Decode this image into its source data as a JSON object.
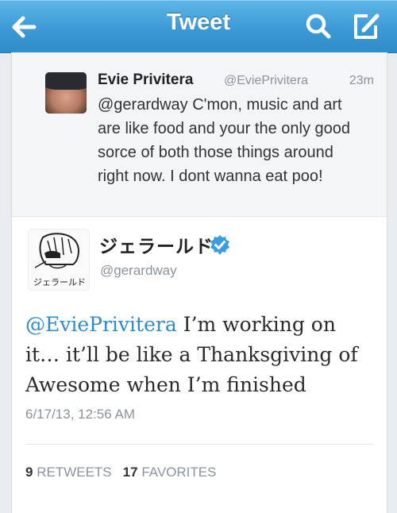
{
  "nav": {
    "title": "Tweet",
    "back_icon": "back-arrow-icon",
    "search_icon": "search-icon",
    "compose_icon": "compose-icon"
  },
  "reply_tweet": {
    "name": "Evie Privitera",
    "handle": "@EviePrivitera",
    "time": "23m",
    "text": "@gerardway C'mon, music and art are like food and your the only good sorce of both those things around right now. I dont wanna eat poo!"
  },
  "main_tweet": {
    "name": "ジェラールド",
    "handle": "@gerardway",
    "avatar_caption": "ジェラールド",
    "mention": "@EviePrivitera",
    "text": " I’m working on it… it’ll be like a Thanksgiving of Awesome when I’m finished",
    "timestamp": "6/17/13, 12:56 AM",
    "retweets_count": "9",
    "retweets_label": "RETWEETS",
    "favorites_count": "17",
    "favorites_label": "FAVORITES"
  },
  "colors": {
    "nav_blue": "#3c9ad6",
    "link_blue": "#2f8bc9",
    "verified_blue": "#3a9de0"
  }
}
